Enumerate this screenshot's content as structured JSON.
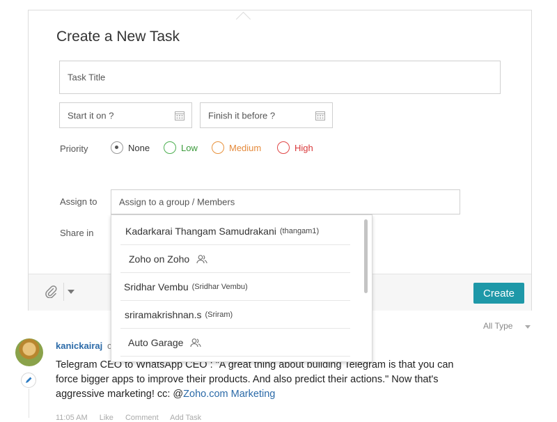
{
  "form": {
    "title": "Create a New Task",
    "task_title_placeholder": "Task Title",
    "start_placeholder": "Start it on ?",
    "finish_placeholder": "Finish it before ?",
    "priority_label": "Priority",
    "priority_options": [
      {
        "label": "None",
        "selected": true,
        "color": "#333333"
      },
      {
        "label": "Low",
        "selected": false,
        "color": "#3a9a3a"
      },
      {
        "label": "Medium",
        "selected": false,
        "color": "#e58a3b"
      },
      {
        "label": "High",
        "selected": false,
        "color": "#d9383a"
      }
    ],
    "assign_label": "Assign to",
    "assign_placeholder": "Assign to a group / Members",
    "share_label": "Share in",
    "create_label": "Create",
    "accent_color": "#1e98a8"
  },
  "dropdown": {
    "items": [
      {
        "name": "Kadarkarai Thangam Samudrakani",
        "sub": "(thangam1)",
        "group": false
      },
      {
        "name": "Zoho on Zoho",
        "sub": "",
        "group": true
      },
      {
        "name": "Sridhar Vembu",
        "sub": "(Sridhar Vembu)",
        "group": false
      },
      {
        "name": "sriramakrishnan.s",
        "sub": "(Sriram)",
        "group": false
      },
      {
        "name": "Auto Garage",
        "sub": "",
        "group": true
      }
    ]
  },
  "feed": {
    "filter_label": "All Type",
    "author": "kanickairaj",
    "author_suffix": "c",
    "post_text": "Telegram CEO to WhatsApp CEO : \"A great thing about building Telegram is that you can force bigger apps to improve their products. And also predict their actions.\" Now that's aggressive marketing! cc: @",
    "post_link": "Zoho.com Marketing",
    "meta": [
      "11:05 AM",
      "Like",
      "Comment",
      "Add Task"
    ]
  }
}
